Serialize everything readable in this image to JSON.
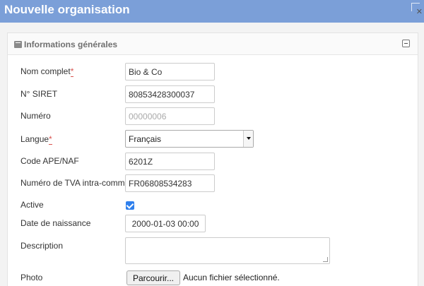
{
  "window": {
    "title": "Nouvelle organisation"
  },
  "panel": {
    "title": "Informations générales"
  },
  "fields": {
    "nom_complet": {
      "label": "Nom complet",
      "required_mark": "*",
      "value": "Bio & Co"
    },
    "siret": {
      "label": "N° SIRET",
      "value": "80853428300037"
    },
    "numero": {
      "label": "Numéro",
      "placeholder": "00000006"
    },
    "langue": {
      "label": "Langue",
      "required_mark": "*",
      "selected": "Français"
    },
    "code_ape": {
      "label": "Code APE/NAF",
      "value": "6201Z"
    },
    "tva": {
      "label": "Numéro de TVA intra-comm...",
      "value": "FR06808534283"
    },
    "active": {
      "label": "Active",
      "checked": true
    },
    "date_naissance": {
      "label": "Date de naissance",
      "value": "2000-01-03 00:00"
    },
    "description": {
      "label": "Description",
      "value": ""
    },
    "photo": {
      "label": "Photo",
      "button_label": "Parcourir...",
      "status": "Aucun fichier sélectionné."
    }
  }
}
